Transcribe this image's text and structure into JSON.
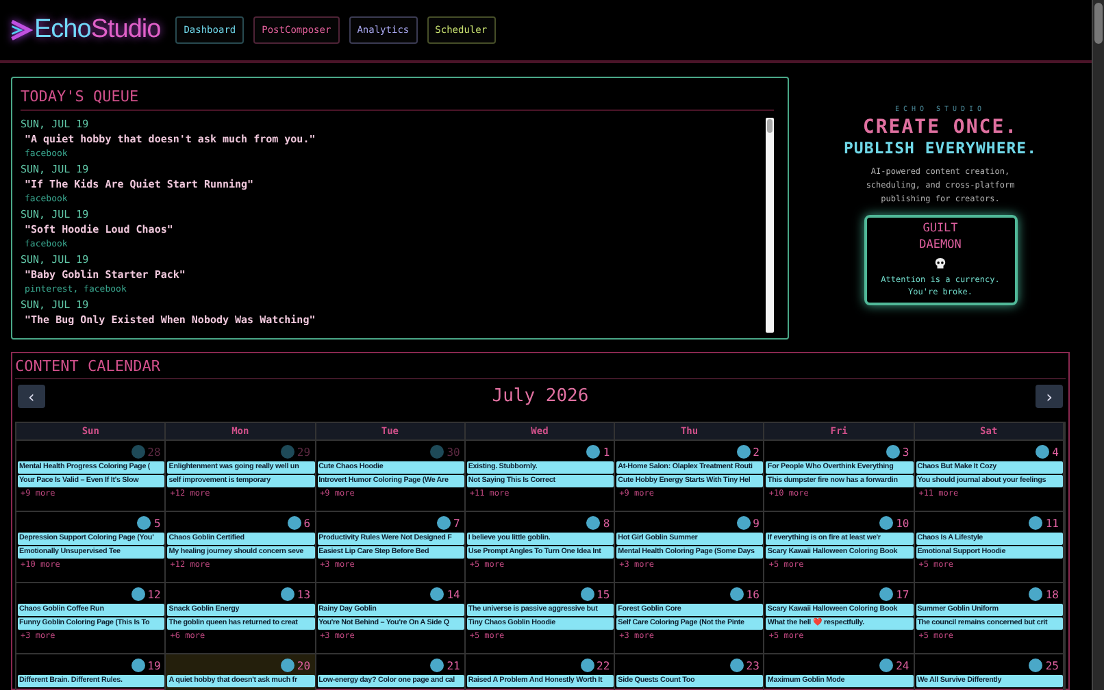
{
  "brand": {
    "name_part1": "Echo",
    "name_part2": "Studio"
  },
  "nav": [
    {
      "label": "Dashboard",
      "color": "#6fd6e8"
    },
    {
      "label": "PostComposer",
      "color": "#e0609a"
    },
    {
      "label": "Analytics",
      "color": "#a9a8f0"
    },
    {
      "label": "Scheduler",
      "color": "#c8e070"
    }
  ],
  "queue": {
    "title": "TODAY'S QUEUE",
    "items": [
      {
        "date": "SUN, JUL 19",
        "title": "\"A quiet hobby that doesn't ask much from you.\"",
        "platforms": "facebook"
      },
      {
        "date": "SUN, JUL 19",
        "title": "\"If The Kids Are Quiet Start Running\"",
        "platforms": "facebook"
      },
      {
        "date": "SUN, JUL 19",
        "title": "\"Soft Hoodie Loud Chaos\"",
        "platforms": "facebook"
      },
      {
        "date": "SUN, JUL 19",
        "title": "\"Baby Goblin Starter Pack\"",
        "platforms": "pinterest, facebook"
      },
      {
        "date": "SUN, JUL 19",
        "title": "\"The Bug Only Existed When Nobody Was Watching\""
      }
    ]
  },
  "promo": {
    "eyebrow": "ECHO STUDIO",
    "headline_1": "CREATE ONCE.",
    "headline_2": "PUBLISH EVERYWHERE.",
    "description": "AI-powered content creation, scheduling, and cross-platform publishing for creators.",
    "card": {
      "title": "GUILT DAEMON",
      "message": "Attention is a currency. You're broke."
    }
  },
  "calendar": {
    "title": "CONTENT CALENDAR",
    "prev": "‹",
    "next": "›",
    "month": "July 2026",
    "weekdays": [
      "Sun",
      "Mon",
      "Tue",
      "Wed",
      "Thu",
      "Fri",
      "Sat"
    ],
    "weeks": [
      [
        {
          "day": "28",
          "in_month": false,
          "today": false,
          "events": [
            "Mental Health Progress Coloring Page (",
            "Your Pace Is Valid – Even If It's Slow"
          ],
          "more": "+9 more"
        },
        {
          "day": "29",
          "in_month": false,
          "today": false,
          "events": [
            "Enlightenment was going really well un",
            "self improvement is temporary"
          ],
          "more": "+12 more"
        },
        {
          "day": "30",
          "in_month": false,
          "today": false,
          "events": [
            "Cute Chaos Hoodie",
            "Introvert Humor Coloring Page (We Are"
          ],
          "more": "+9 more"
        },
        {
          "day": "1",
          "in_month": true,
          "today": false,
          "events": [
            "Existing. Stubbornly.",
            "Not Saying This Is Correct"
          ],
          "more": "+11 more"
        },
        {
          "day": "2",
          "in_month": true,
          "today": false,
          "events": [
            "At-Home Salon: Olaplex Treatment Routi",
            "Cute Hobby Energy Starts With Tiny Hel"
          ],
          "more": "+9 more"
        },
        {
          "day": "3",
          "in_month": true,
          "today": false,
          "events": [
            "For People Who Overthink Everything",
            "This dumpster fire now has a forwardin"
          ],
          "more": "+10 more"
        },
        {
          "day": "4",
          "in_month": true,
          "today": false,
          "events": [
            "Chaos But Make It Cozy",
            "You should journal about your feelings"
          ],
          "more": "+11 more"
        }
      ],
      [
        {
          "day": "5",
          "in_month": true,
          "today": false,
          "events": [
            "Depression Support Coloring Page (You'",
            "Emotionally Unsupervised Tee"
          ],
          "more": "+10 more"
        },
        {
          "day": "6",
          "in_month": true,
          "today": false,
          "events": [
            "Chaos Goblin Certified",
            "My healing journey should concern seve"
          ],
          "more": "+12 more"
        },
        {
          "day": "7",
          "in_month": true,
          "today": false,
          "events": [
            "Productivity Rules Were Not Designed F",
            "Easiest Lip Care Step Before Bed"
          ],
          "more": "+3 more"
        },
        {
          "day": "8",
          "in_month": true,
          "today": false,
          "events": [
            "I believe you little goblin.",
            "Use Prompt Angles To Turn One Idea Int"
          ],
          "more": "+5 more"
        },
        {
          "day": "9",
          "in_month": true,
          "today": false,
          "events": [
            "Hot Girl Goblin Summer",
            "Mental Health Coloring Page (Some Days"
          ],
          "more": "+3 more"
        },
        {
          "day": "10",
          "in_month": true,
          "today": false,
          "events": [
            "If everything is on fire at least we'r",
            "Scary Kawaii Halloween Coloring Book"
          ],
          "more": "+5 more"
        },
        {
          "day": "11",
          "in_month": true,
          "today": false,
          "events": [
            "Chaos Is A Lifestyle",
            "Emotional Support Hoodie"
          ],
          "more": "+5 more"
        }
      ],
      [
        {
          "day": "12",
          "in_month": true,
          "today": false,
          "events": [
            "Chaos Goblin Coffee Run",
            "Funny Goblin Coloring Page (This Is To"
          ],
          "more": "+3 more"
        },
        {
          "day": "13",
          "in_month": true,
          "today": false,
          "events": [
            "Snack Goblin Energy",
            "The goblin queen has returned to creat"
          ],
          "more": "+6 more"
        },
        {
          "day": "14",
          "in_month": true,
          "today": false,
          "events": [
            "Rainy Day Goblin",
            "You're Not Behind – You're On A Side Q"
          ],
          "more": "+3 more"
        },
        {
          "day": "15",
          "in_month": true,
          "today": false,
          "events": [
            "The universe is passive aggressive but",
            "Tiny Chaos Goblin Hoodie"
          ],
          "more": "+5 more"
        },
        {
          "day": "16",
          "in_month": true,
          "today": false,
          "events": [
            "Forest Goblin Core",
            "Self Care Coloring Page (Not the Pinte"
          ],
          "more": "+3 more"
        },
        {
          "day": "17",
          "in_month": true,
          "today": false,
          "events": [
            "Scary Kawaii Halloween Coloring Book",
            "What the hell ❤️ respectfully."
          ],
          "more": "+5 more"
        },
        {
          "day": "18",
          "in_month": true,
          "today": false,
          "events": [
            "Summer Goblin Uniform",
            "The council remains concerned but crit"
          ],
          "more": "+5 more"
        }
      ],
      [
        {
          "day": "19",
          "in_month": true,
          "today": false,
          "events": [
            "Different Brain. Different Rules."
          ]
        },
        {
          "day": "20",
          "in_month": true,
          "today": true,
          "events": [
            "A quiet hobby that doesn't ask much fr"
          ]
        },
        {
          "day": "21",
          "in_month": true,
          "today": false,
          "events": [
            "Low-energy day? Color one page and cal"
          ]
        },
        {
          "day": "22",
          "in_month": true,
          "today": false,
          "events": [
            "Raised A Problem And Honestly Worth It"
          ]
        },
        {
          "day": "23",
          "in_month": true,
          "today": false,
          "events": [
            "Side Quests Count Too"
          ]
        },
        {
          "day": "24",
          "in_month": true,
          "today": false,
          "events": [
            "Maximum Goblin Mode"
          ]
        },
        {
          "day": "25",
          "in_month": true,
          "today": false,
          "events": [
            "We All Survive Differently"
          ]
        }
      ]
    ]
  }
}
